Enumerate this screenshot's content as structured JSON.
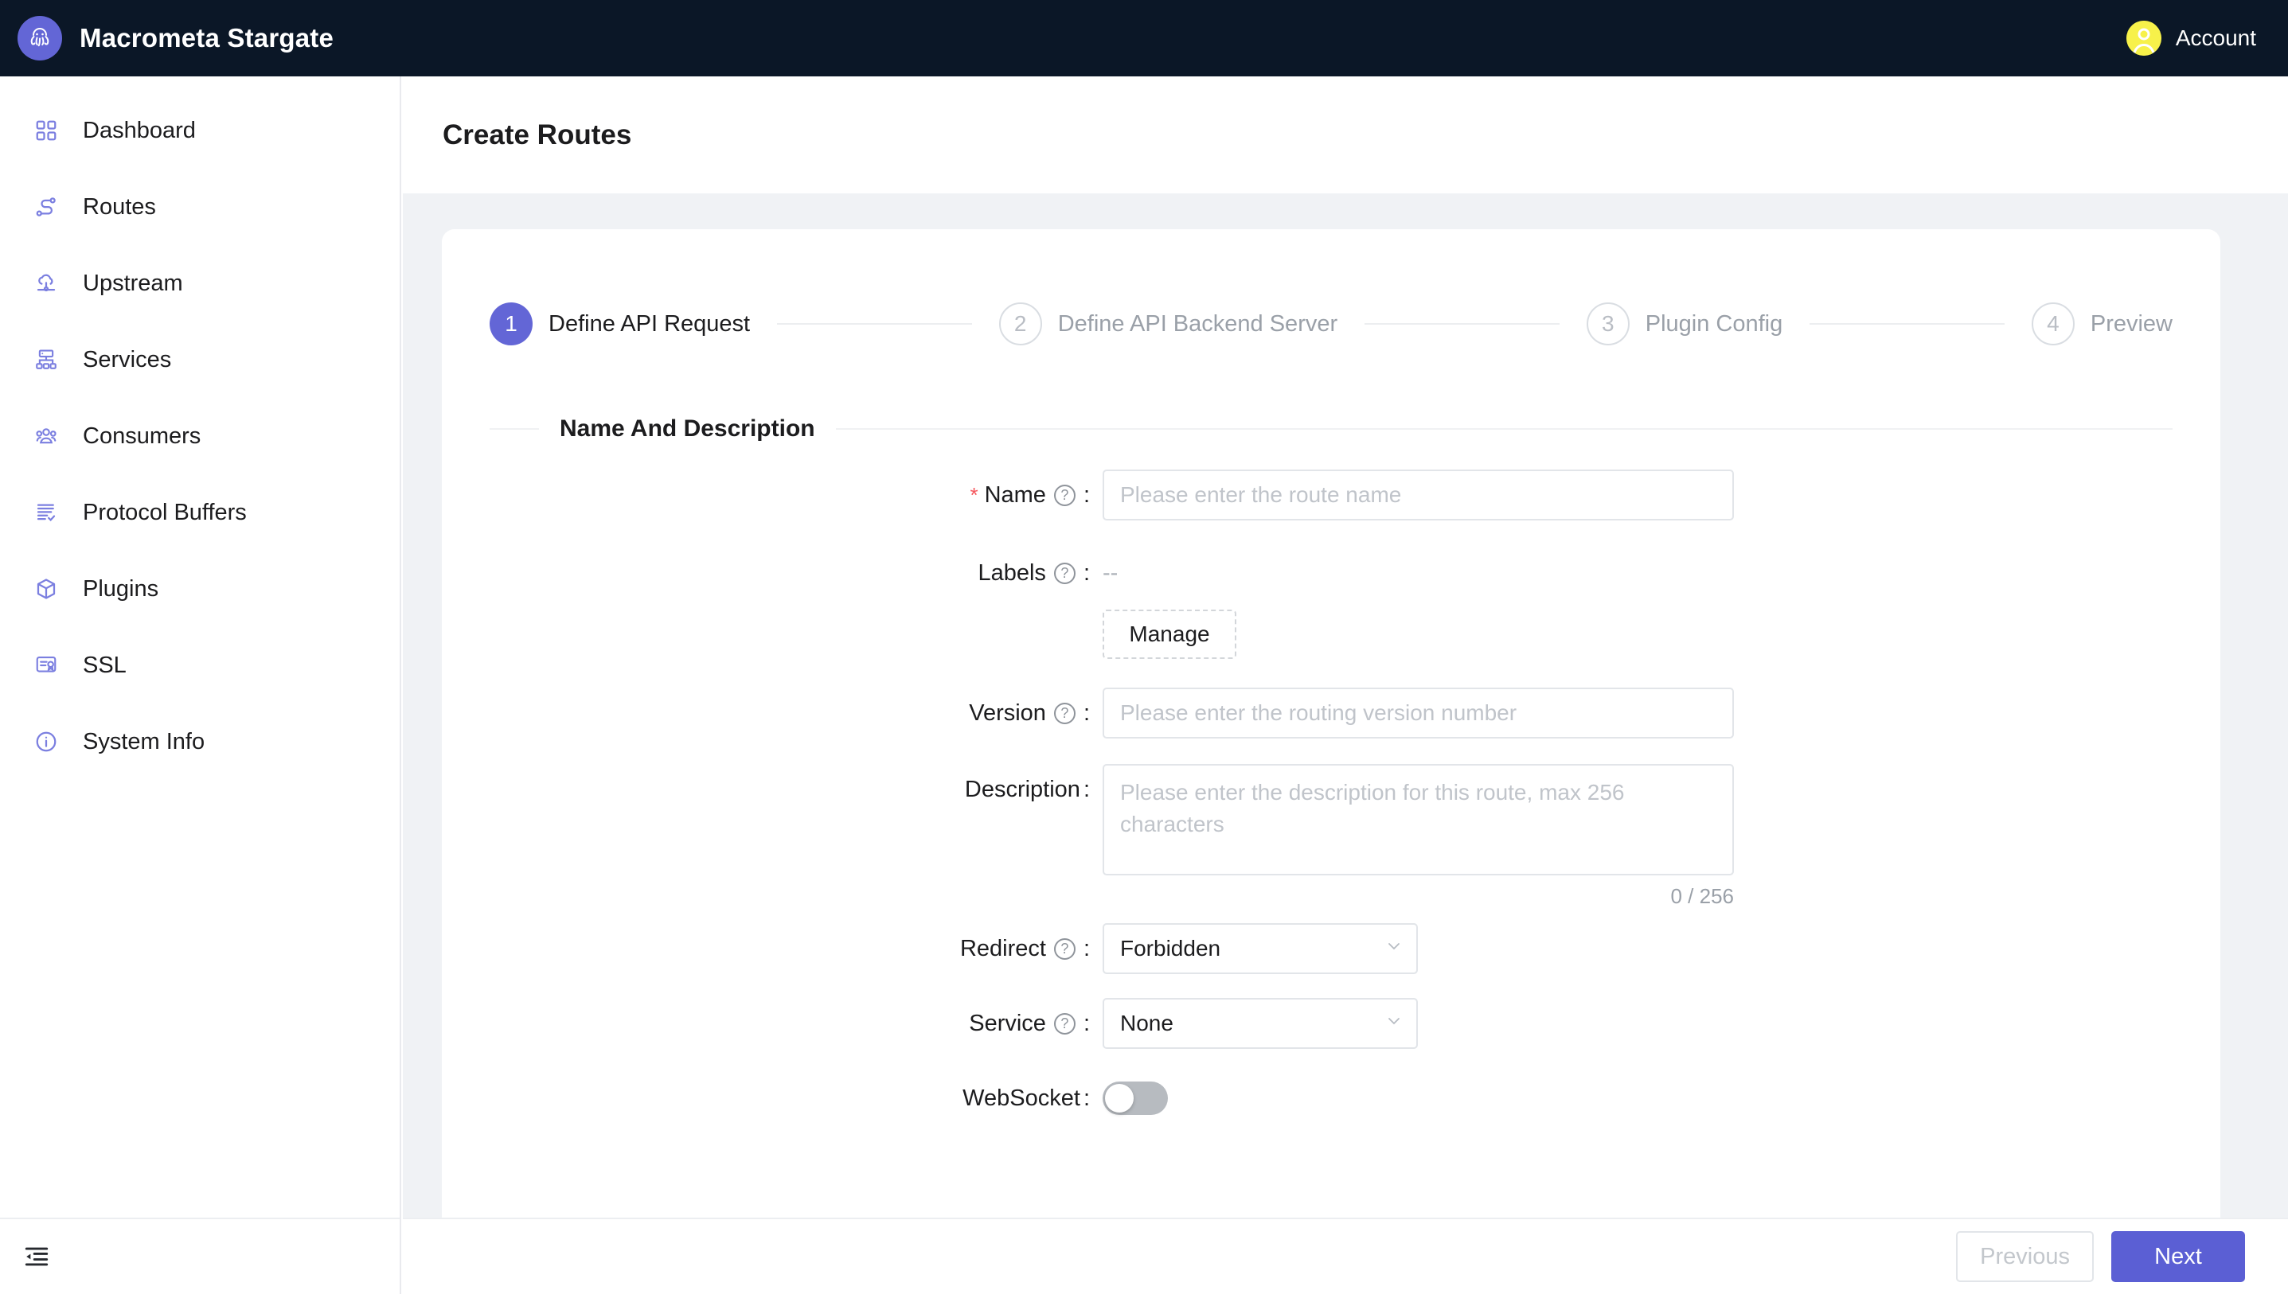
{
  "topbar": {
    "logo_icon": "octopus-logo-icon",
    "brand_title": "Macrometa Stargate",
    "account_label": "Account",
    "avatar_icon": "user-avatar-icon",
    "brand_color": "#6366d6",
    "bar_color": "#0b1727",
    "avatar_color": "#f7f14a"
  },
  "sidebar": {
    "items": [
      {
        "label": "Dashboard",
        "icon": "dashboard-grid-icon"
      },
      {
        "label": "Routes",
        "icon": "routes-path-icon"
      },
      {
        "label": "Upstream",
        "icon": "upstream-cloud-icon"
      },
      {
        "label": "Services",
        "icon": "services-hierarchy-icon"
      },
      {
        "label": "Consumers",
        "icon": "consumers-people-icon"
      },
      {
        "label": "Protocol Buffers",
        "icon": "protocol-buffers-doc-icon"
      },
      {
        "label": "Plugins",
        "icon": "plugins-box-icon"
      },
      {
        "label": "SSL",
        "icon": "ssl-certificate-icon"
      },
      {
        "label": "System Info",
        "icon": "system-info-icon"
      }
    ],
    "collapse_icon": "menu-fold-icon",
    "icon_color": "#7b7fe0"
  },
  "page": {
    "title": "Create Routes"
  },
  "steps": {
    "active_index": 0,
    "items": [
      {
        "number": "1",
        "label": "Define API Request"
      },
      {
        "number": "2",
        "label": "Define API Backend Server"
      },
      {
        "number": "3",
        "label": "Plugin Config"
      },
      {
        "number": "4",
        "label": "Preview"
      }
    ],
    "active_color": "#6366d6"
  },
  "form": {
    "section_title": "Name And Description",
    "name": {
      "label": "Name",
      "required_mark": "*",
      "help_icon": "question-circle-icon",
      "colon": ":",
      "value": "",
      "placeholder": "Please enter the route name"
    },
    "labels": {
      "label": "Labels",
      "help_icon": "question-circle-icon",
      "colon": ":",
      "value": "--",
      "manage_button": "Manage"
    },
    "version": {
      "label": "Version",
      "help_icon": "question-circle-icon",
      "colon": ":",
      "value": "",
      "placeholder": "Please enter the routing version number"
    },
    "description": {
      "label": "Description",
      "colon": ":",
      "value": "",
      "placeholder": "Please enter the description for this route, max 256 characters",
      "counter": "0 / 256"
    },
    "redirect": {
      "label": "Redirect",
      "help_icon": "question-circle-icon",
      "colon": ":",
      "selected": "Forbidden",
      "chevron_icon": "chevron-down-icon"
    },
    "service": {
      "label": "Service",
      "help_icon": "question-circle-icon",
      "colon": ":",
      "selected": "None",
      "chevron_icon": "chevron-down-icon"
    },
    "websocket": {
      "label": "WebSocket",
      "colon": ":",
      "enabled": false
    }
  },
  "footer": {
    "previous_label": "Previous",
    "next_label": "Next",
    "next_color": "#5b5fd4"
  }
}
